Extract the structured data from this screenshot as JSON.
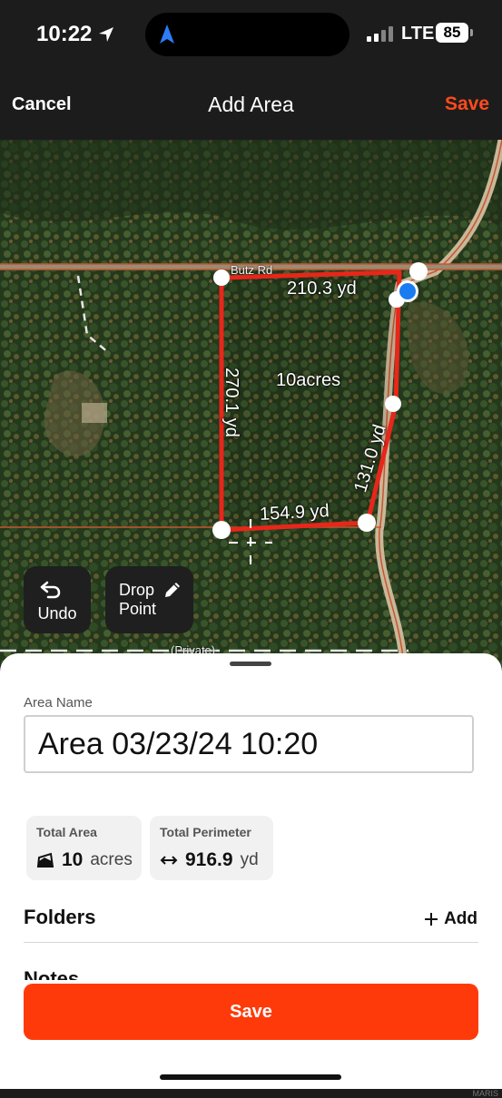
{
  "status": {
    "time": "10:22",
    "network": "LTE",
    "battery": "85"
  },
  "nav": {
    "cancel": "Cancel",
    "title": "Add Area",
    "save": "Save"
  },
  "map": {
    "road_label": "Butz Rd",
    "private_label": "(Private)",
    "area_label": "10acres",
    "edges": {
      "top": "210.3 yd",
      "left": "270.1 yd",
      "right": "131.0 yd",
      "bottom": "154.9 yd"
    },
    "undo": "Undo",
    "drop_point": "Drop Point"
  },
  "sheet": {
    "area_name_label": "Area Name",
    "area_name_value": "Area 03/23/24 10:20",
    "total_area": {
      "label": "Total Area",
      "value": "10",
      "unit": "acres"
    },
    "total_perimeter": {
      "label": "Total Perimeter",
      "value": "916.9",
      "unit": "yd"
    },
    "folders": "Folders",
    "add": "Add",
    "notes": "Notes",
    "save": "Save",
    "watermark": "MARIS"
  },
  "colors": {
    "accent": "#ff3a0a",
    "boundary": "#e8261a",
    "location": "#1a7cf0"
  },
  "icons": [
    "location-arrow-icon",
    "navigation-arrow-icon",
    "undo-icon",
    "pencil-icon",
    "area-icon",
    "arrows-horizontal-icon",
    "plus-icon"
  ]
}
